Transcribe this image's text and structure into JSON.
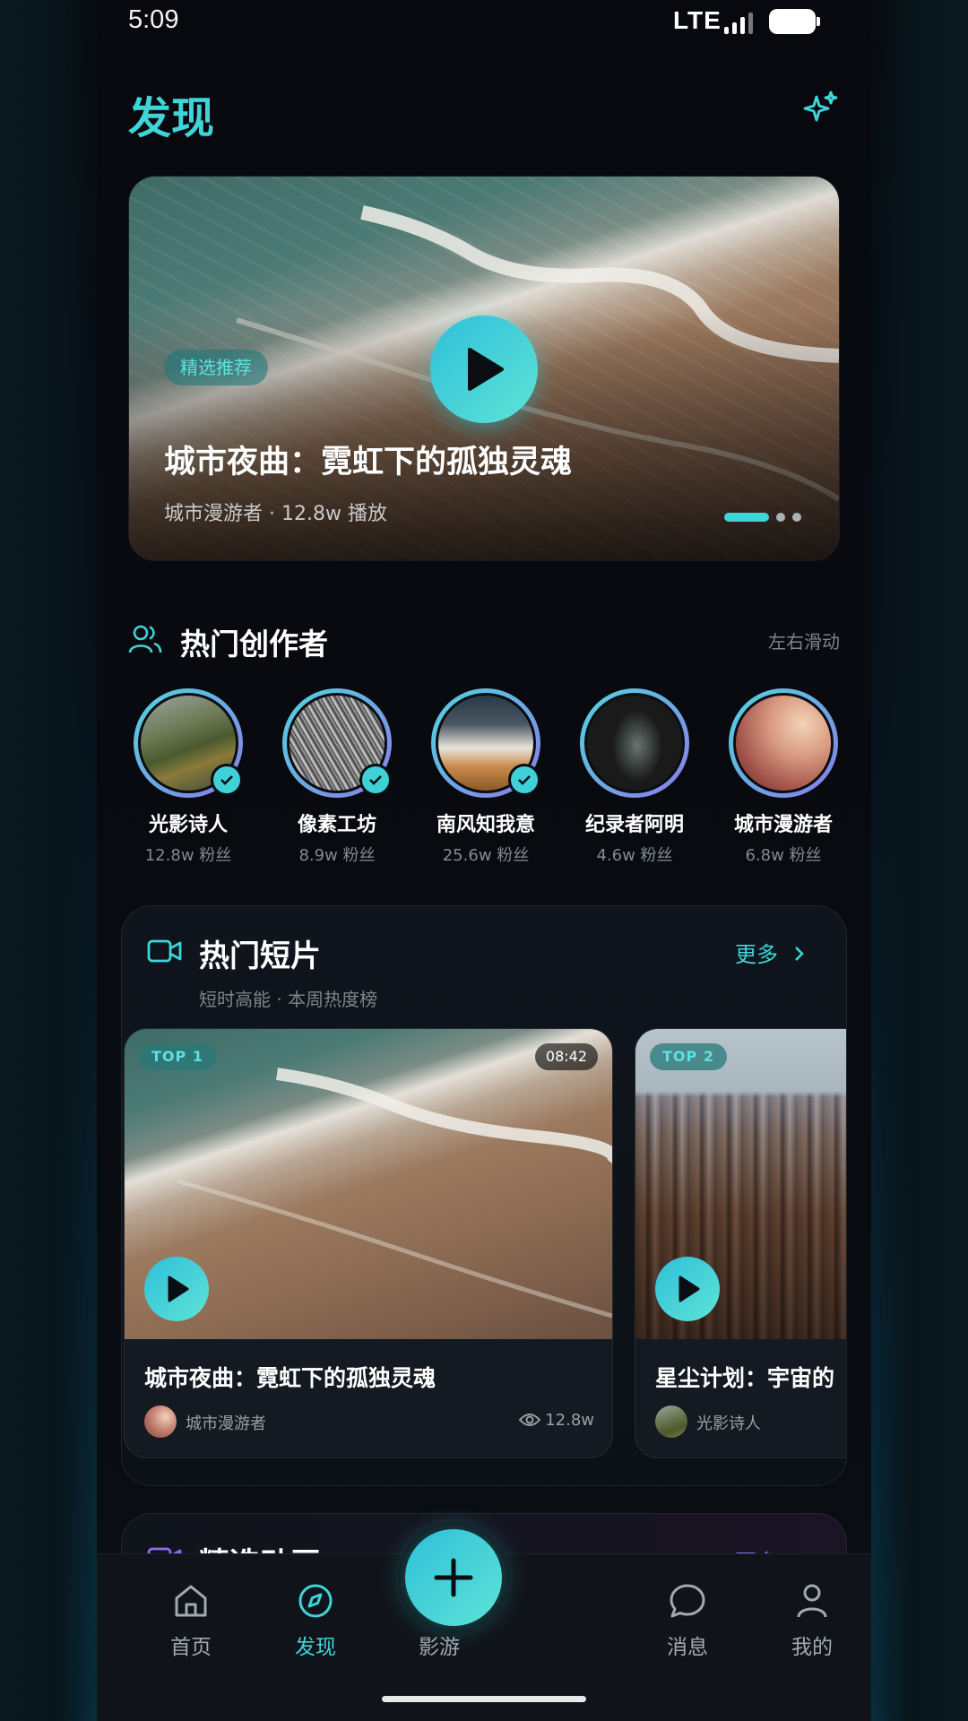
{
  "status_bar": {
    "time": "5:09",
    "network": "LTE"
  },
  "header": {
    "title": "发现",
    "sparkle_icon": "sparkle-icon"
  },
  "hero": {
    "tag": "精选推荐",
    "title": "城市夜曲：霓虹下的孤独灵魂",
    "meta": "城市漫游者 · 12.8w 播放",
    "carousel_count": 3,
    "carousel_active": 1
  },
  "creators": {
    "title": "热门创作者",
    "hint": "左右滑动",
    "items": [
      {
        "name": "光影诗人",
        "fans": "12.8w 粉丝",
        "verified": true
      },
      {
        "name": "像素工坊",
        "fans": "8.9w 粉丝",
        "verified": true
      },
      {
        "name": "南风知我意",
        "fans": "25.6w 粉丝",
        "verified": true
      },
      {
        "name": "纪录者阿明",
        "fans": "4.6w 粉丝",
        "verified": false
      },
      {
        "name": "城市漫游者",
        "fans": "6.8w 粉丝",
        "verified": false
      }
    ]
  },
  "hot_shorts": {
    "title": "热门短片",
    "subtitle": "短时高能 · 本周热度榜",
    "more": "更多",
    "cards": [
      {
        "rank": "TOP 1",
        "duration": "08:42",
        "title": "城市夜曲：霓虹下的孤独灵魂",
        "author": "城市漫游者",
        "views": "12.8w"
      },
      {
        "rank": "TOP 2",
        "title": "星尘计划：宇宙的",
        "author": "光影诗人"
      }
    ]
  },
  "next_section": {
    "title": "精选动画",
    "more": "更多"
  },
  "tabbar": {
    "items": [
      {
        "label": "首页",
        "icon": "home-icon"
      },
      {
        "label": "发现",
        "icon": "compass-icon",
        "active": true
      },
      {
        "label": "影游",
        "icon": "gamepad-icon"
      },
      {
        "label": "消息",
        "icon": "chat-icon"
      },
      {
        "label": "我的",
        "icon": "user-icon"
      }
    ],
    "fab_icon": "plus-icon"
  },
  "colors": {
    "accent": "#3fd4d8",
    "accent2": "#8e6ee8",
    "background": "#07090e"
  }
}
